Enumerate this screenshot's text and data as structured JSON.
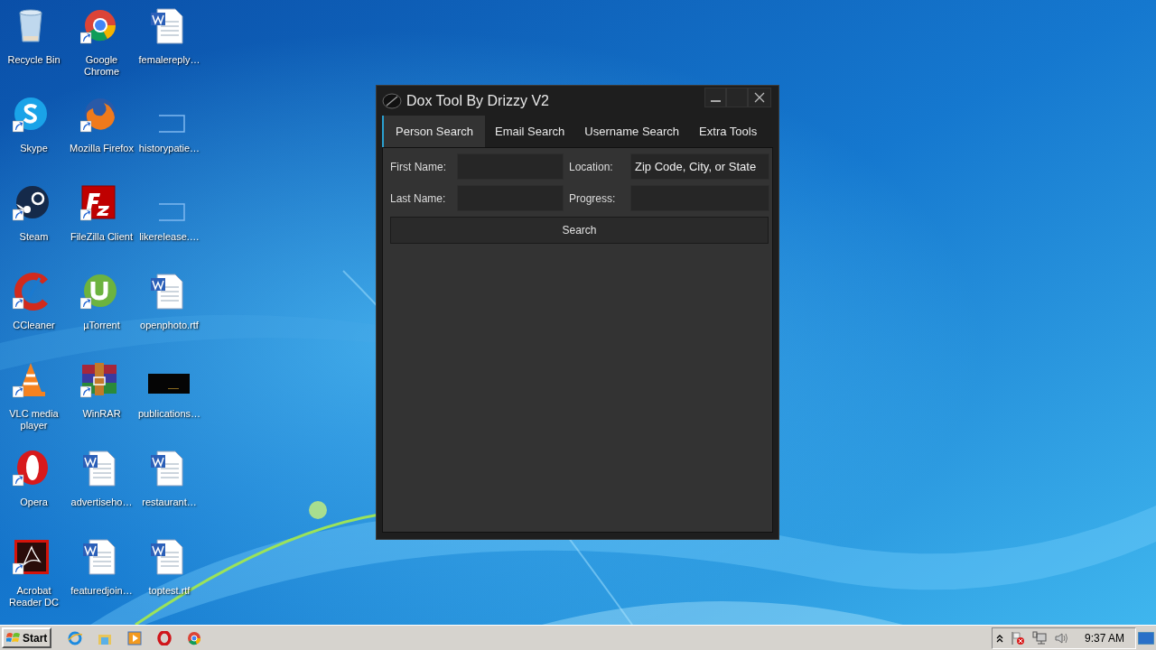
{
  "desktop_icons": [
    {
      "label": "Recycle Bin",
      "kind": "recycle",
      "shortcut": false
    },
    {
      "label": "Google Chrome",
      "kind": "chrome",
      "shortcut": true
    },
    {
      "label": "femalereply…",
      "kind": "word",
      "shortcut": false
    },
    {
      "label": "Skype",
      "kind": "skype",
      "shortcut": true
    },
    {
      "label": "Mozilla Firefox",
      "kind": "firefox",
      "shortcut": true
    },
    {
      "label": "historypatie…",
      "kind": "blank",
      "shortcut": false
    },
    {
      "label": "Steam",
      "kind": "steam",
      "shortcut": true
    },
    {
      "label": "FileZilla Client",
      "kind": "filezilla",
      "shortcut": true
    },
    {
      "label": "likerelease.…",
      "kind": "blank",
      "shortcut": false
    },
    {
      "label": "CCleaner",
      "kind": "ccleaner",
      "shortcut": true
    },
    {
      "label": "µTorrent",
      "kind": "utorrent",
      "shortcut": true
    },
    {
      "label": "openphoto.rtf",
      "kind": "word",
      "shortcut": false
    },
    {
      "label": "VLC media player",
      "kind": "vlc",
      "shortcut": true
    },
    {
      "label": "WinRAR",
      "kind": "winrar",
      "shortcut": true
    },
    {
      "label": "publications…",
      "kind": "thumb",
      "shortcut": false
    },
    {
      "label": "Opera",
      "kind": "opera",
      "shortcut": true
    },
    {
      "label": "advertiseho…",
      "kind": "word",
      "shortcut": false
    },
    {
      "label": "restaurant…",
      "kind": "word",
      "shortcut": false
    },
    {
      "label": "Acrobat Reader DC",
      "kind": "acrobat",
      "shortcut": true
    },
    {
      "label": "featuredjoin…",
      "kind": "word",
      "shortcut": false
    },
    {
      "label": "toptest.rtf",
      "kind": "word",
      "shortcut": false
    }
  ],
  "window": {
    "title": "Dox Tool By Drizzy V2",
    "tabs": [
      {
        "label": "Person Search",
        "selected": true
      },
      {
        "label": "Email Search",
        "selected": false
      },
      {
        "label": "Username Search",
        "selected": false
      },
      {
        "label": "Extra Tools",
        "selected": false
      }
    ],
    "fields": [
      {
        "label": "First Name:"
      },
      {
        "label": "Location:",
        "value": "Zip Code, City, or State"
      },
      {
        "label": "Last Name:"
      },
      {
        "label": "Progress:"
      }
    ],
    "search_button": "Search"
  },
  "taskbar": {
    "start": "Start",
    "apps": [
      {
        "kind": "ie"
      },
      {
        "kind": "explorer"
      },
      {
        "kind": "media"
      },
      {
        "kind": "opera"
      },
      {
        "kind": "chrome"
      }
    ],
    "clock": "9:37 AM"
  }
}
